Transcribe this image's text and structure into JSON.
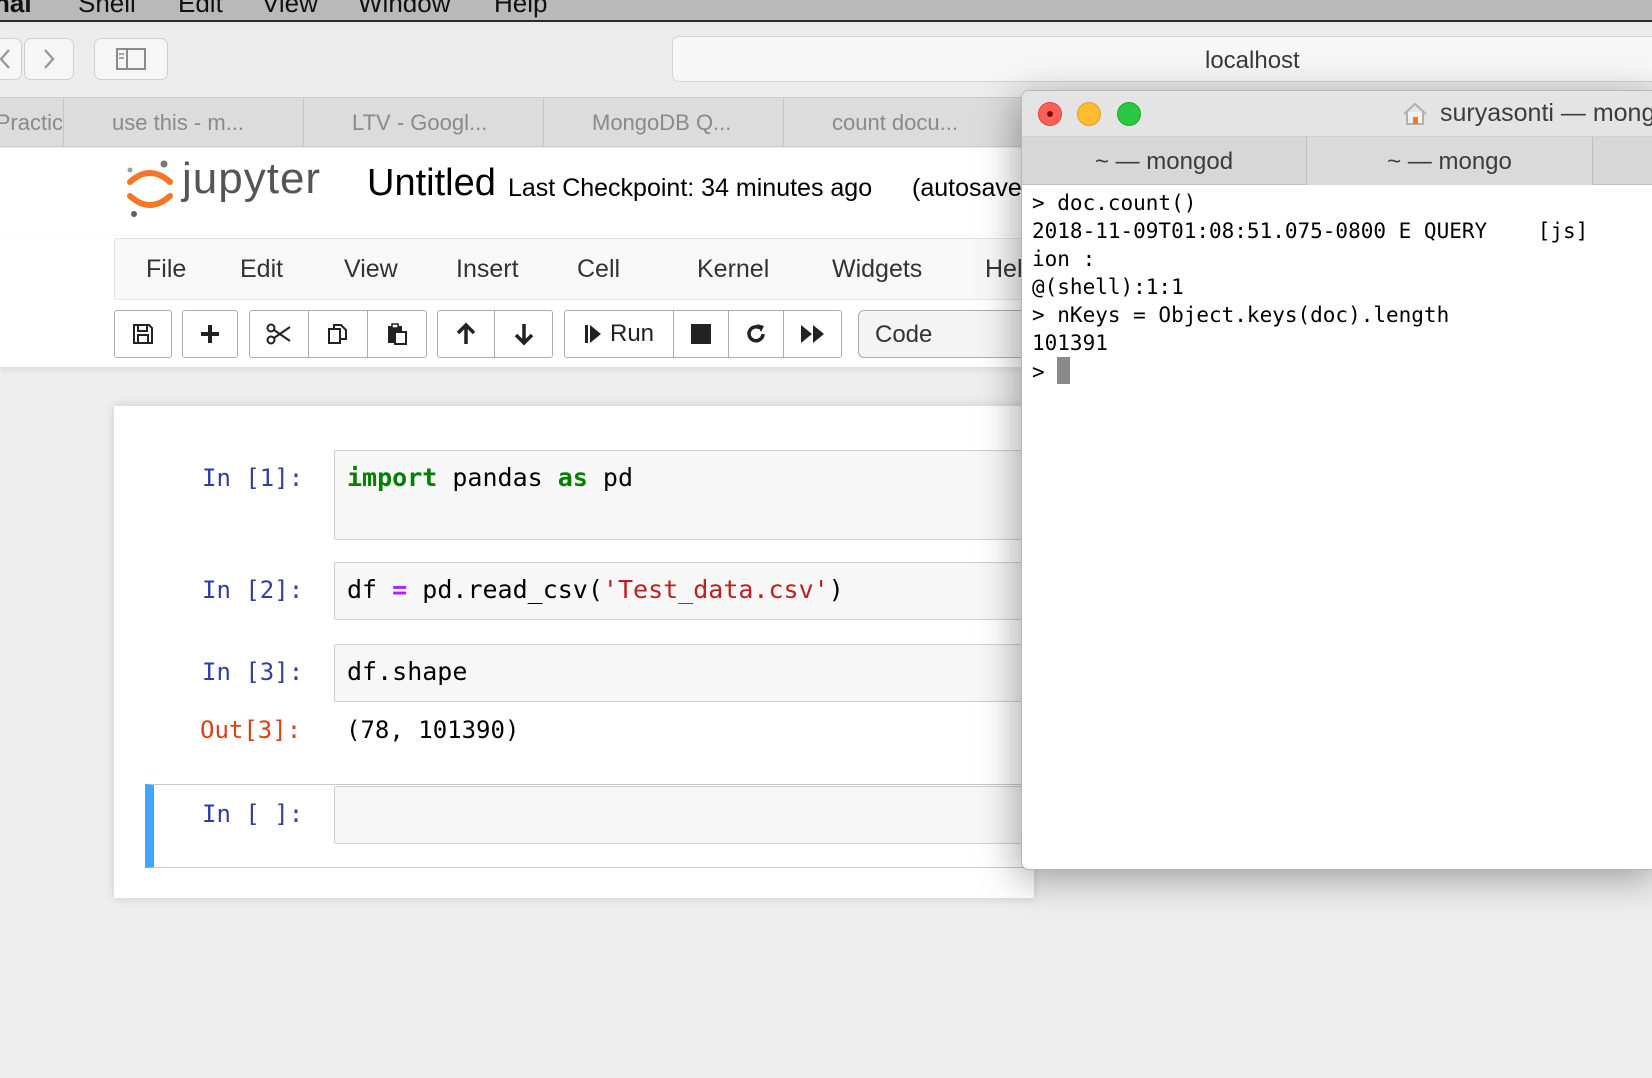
{
  "menubar": {
    "items": [
      "nal",
      "Shell",
      "Edit",
      "View",
      "Window",
      "Help"
    ]
  },
  "browser": {
    "address": "localhost",
    "tabs": [
      "Practic",
      "use this - m...",
      "LTV - Googl...",
      "MongoDB Q...",
      "count docu..."
    ]
  },
  "jupyter": {
    "logo_text": "jupyter",
    "notebook_title": "Untitled",
    "checkpoint": "Last Checkpoint: 34 minutes ago",
    "autosave": "(autosaved)",
    "menu": [
      "File",
      "Edit",
      "View",
      "Insert",
      "Cell",
      "Kernel",
      "Widgets",
      "Help"
    ],
    "toolbar": {
      "run_label": "Run",
      "cell_type": "Code"
    },
    "cells": [
      {
        "prompt": "In [1]:",
        "code": [
          "import",
          "pandas",
          "as",
          "pd"
        ]
      },
      {
        "prompt": "In [2]:",
        "code": [
          "df",
          "=",
          "pd.read_csv(",
          "'Test_data.csv'",
          ")"
        ]
      },
      {
        "prompt": "In [3]:",
        "code": [
          "df.shape"
        ],
        "out_prompt": "Out[3]:",
        "output": "(78, 101390)"
      },
      {
        "prompt": "In [ ]:",
        "code": []
      }
    ]
  },
  "terminal": {
    "title": "suryasonti — mongo",
    "tabs": [
      "~ — mongod",
      "~ — mongo"
    ],
    "lines": [
      "> doc.count()",
      "2018-11-09T01:08:51.075-0800 E QUERY    [js]",
      "ion :",
      "@(shell):1:1",
      "> nKeys = Object.keys(doc).length",
      "101391",
      "> "
    ],
    "colors": {
      "close": "#fe5f57",
      "minimize": "#febc2e",
      "zoom": "#28c840"
    }
  },
  "colors": {
    "jupyter_orange": "#f37726",
    "prompt_in": "#303f9f",
    "prompt_out": "#d84315",
    "selected_cell": "#42a5f5"
  }
}
